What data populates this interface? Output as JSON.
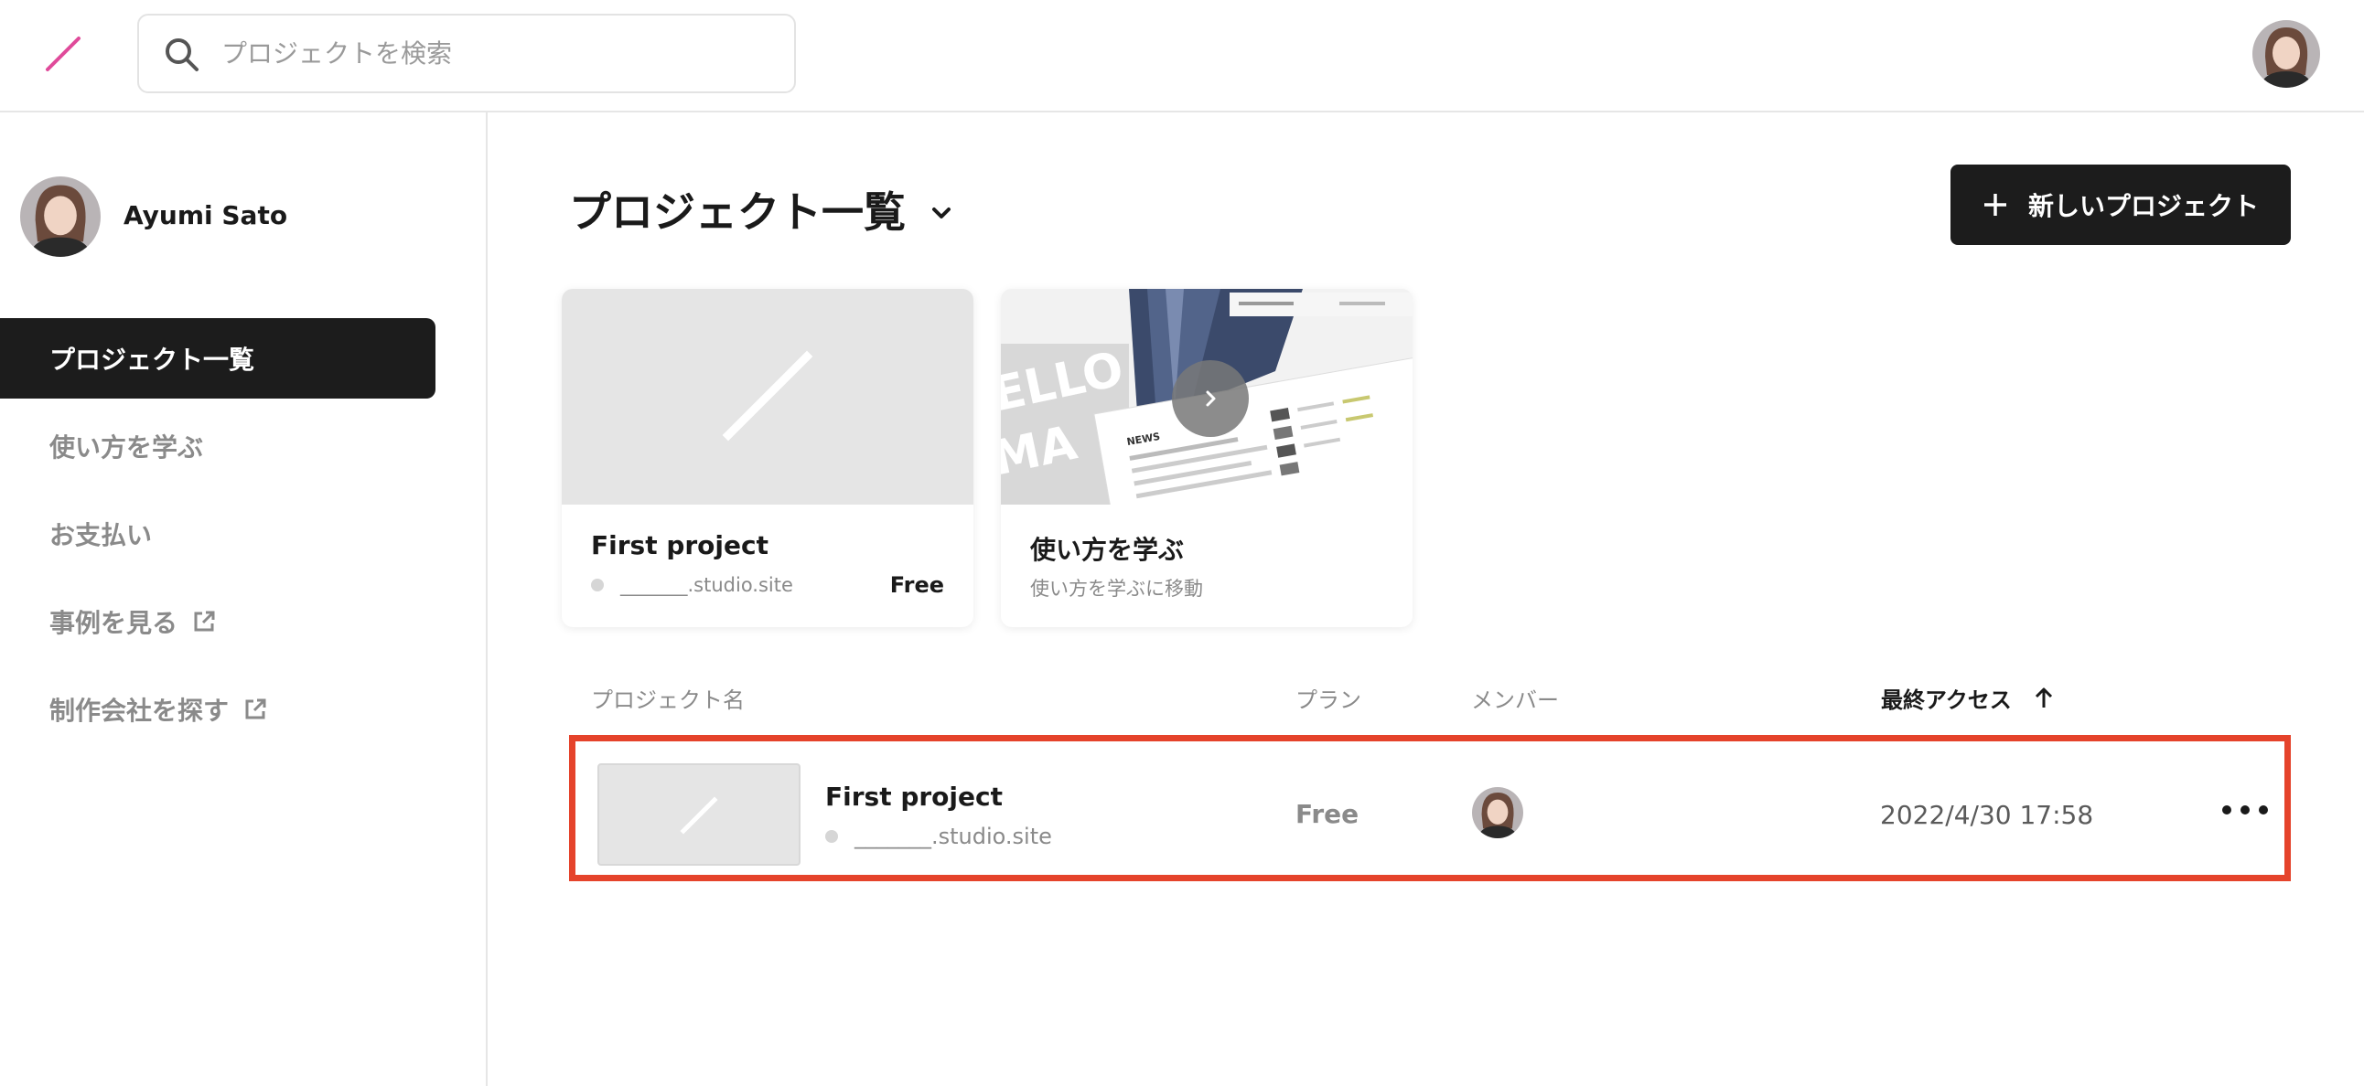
{
  "header": {
    "search_placeholder": "プロジェクトを検索",
    "brand_color": "#e04a9a"
  },
  "sidebar": {
    "user_name": "Ayumi Sato",
    "items": [
      {
        "label": "プロジェクト一覧",
        "active": true
      },
      {
        "label": "使い方を学ぶ",
        "active": false
      },
      {
        "label": "お支払い",
        "active": false
      },
      {
        "label": "事例を見る",
        "active": false,
        "external": true
      },
      {
        "label": "制作会社を探す",
        "active": false,
        "external": true
      }
    ]
  },
  "main": {
    "title": "プロジェクト一覧",
    "new_project_label": "新しいプロジェクト",
    "cards": [
      {
        "title": "First project",
        "url": "_______.studio.site",
        "plan": "Free"
      },
      {
        "title": "使い方を学ぶ",
        "subtitle": "使い方を学ぶに移動"
      }
    ],
    "learn_preview": {
      "hero_text_1": "ELLO",
      "hero_text_2": "MA",
      "news_label": "NEWS"
    },
    "table": {
      "headers": {
        "name": "プロジェクト名",
        "plan": "プラン",
        "members": "メンバー",
        "last_access": "最終アクセス"
      },
      "rows": [
        {
          "name": "First project",
          "url": "_______.studio.site",
          "plan": "Free",
          "last_access": "2022/4/30 17:58"
        }
      ]
    },
    "highlight_color": "#e5432b"
  }
}
